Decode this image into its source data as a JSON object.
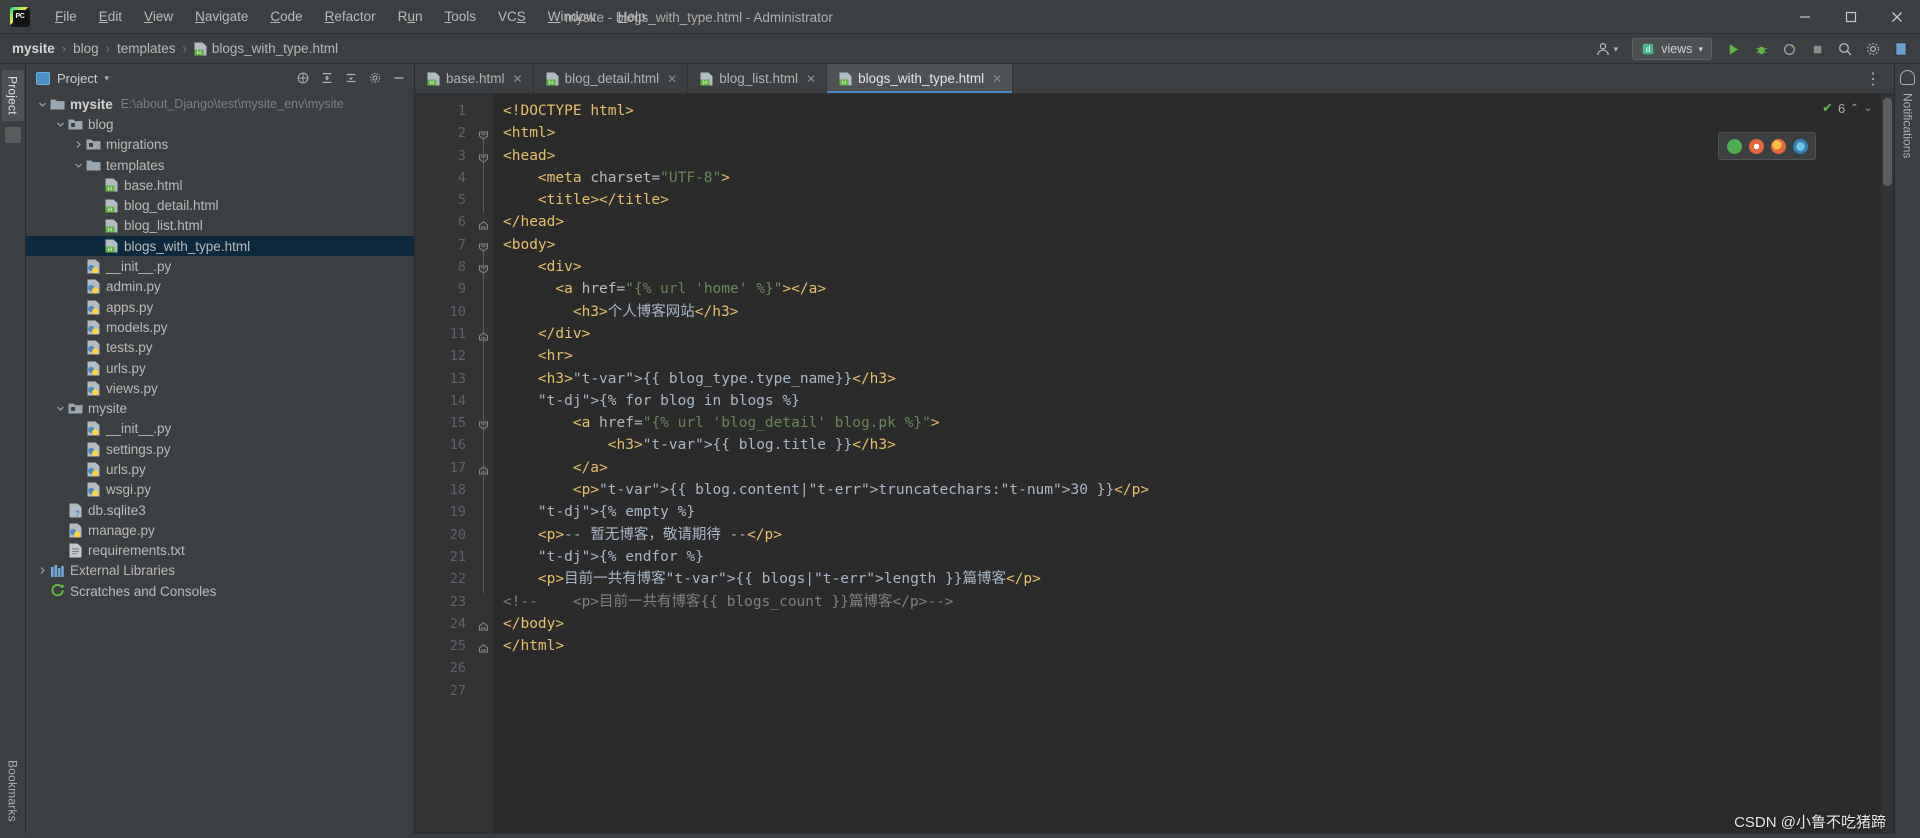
{
  "window": {
    "title": "mysite - blogs_with_type.html - Administrator",
    "logo_text": "PC",
    "minimize": "minimize-icon",
    "maximize": "maximize-icon",
    "close": "close-icon"
  },
  "menu": {
    "items": [
      {
        "label": "File",
        "mnemonic": "F"
      },
      {
        "label": "Edit",
        "mnemonic": "E"
      },
      {
        "label": "View",
        "mnemonic": "V"
      },
      {
        "label": "Navigate",
        "mnemonic": "N"
      },
      {
        "label": "Code",
        "mnemonic": "C"
      },
      {
        "label": "Refactor",
        "mnemonic": "R"
      },
      {
        "label": "Run",
        "mnemonic": "u"
      },
      {
        "label": "Tools",
        "mnemonic": "T"
      },
      {
        "label": "VCS",
        "mnemonic": "S"
      },
      {
        "label": "Window",
        "mnemonic": "W"
      },
      {
        "label": "Help",
        "mnemonic": "H"
      }
    ]
  },
  "breadcrumb": {
    "items": [
      "mysite",
      "blog",
      "templates",
      "blogs_with_type.html"
    ],
    "separator": "›"
  },
  "navbar_right": {
    "views_label": "views",
    "user_icon": "user-account-icon",
    "run_icon": "run-icon",
    "debug_icon": "debug-icon",
    "coverage_icon": "run-with-coverage-icon",
    "stop_icon": "stop-icon",
    "search_icon": "search-everywhere-icon",
    "settings_icon": "settings-gear-icon",
    "plugin_icon": "plugin-icon"
  },
  "left_strip": {
    "top_tab": "Project",
    "bottom_tab": "Bookmarks"
  },
  "right_strip": {
    "tab": "Notifications"
  },
  "project_panel": {
    "title": "Project",
    "dropdown_icon": "chevron-down-icon",
    "actions": [
      {
        "name": "expand-collapse-icon",
        "label": "⊕"
      },
      {
        "name": "collapse-all-icon",
        "label": "⤓"
      },
      {
        "name": "scroll-from-source-icon",
        "label": "↥"
      },
      {
        "name": "settings-gear-icon",
        "label": "⚙"
      },
      {
        "name": "hide-icon",
        "label": "—"
      }
    ],
    "tree": [
      {
        "label": "mysite",
        "path": "E:\\about_Django\\test\\mysite_env\\mysite",
        "icon": "folder-icon",
        "indent": 0,
        "arrow": "down",
        "bold": true,
        "selected": false
      },
      {
        "label": "blog",
        "path": "",
        "icon": "module-folder-icon",
        "indent": 1,
        "arrow": "down",
        "bold": false,
        "selected": false
      },
      {
        "label": "migrations",
        "path": "",
        "icon": "module-folder-icon",
        "indent": 2,
        "arrow": "right",
        "bold": false,
        "selected": false
      },
      {
        "label": "templates",
        "path": "",
        "icon": "folder-icon",
        "indent": 2,
        "arrow": "down",
        "bold": false,
        "selected": false
      },
      {
        "label": "base.html",
        "path": "",
        "icon": "html-file-icon",
        "indent": 3,
        "arrow": "none",
        "bold": false,
        "selected": false
      },
      {
        "label": "blog_detail.html",
        "path": "",
        "icon": "html-file-icon",
        "indent": 3,
        "arrow": "none",
        "bold": false,
        "selected": false
      },
      {
        "label": "blog_list.html",
        "path": "",
        "icon": "html-file-icon",
        "indent": 3,
        "arrow": "none",
        "bold": false,
        "selected": false
      },
      {
        "label": "blogs_with_type.html",
        "path": "",
        "icon": "html-file-icon",
        "indent": 3,
        "arrow": "none",
        "bold": false,
        "selected": true
      },
      {
        "label": "__init__.py",
        "path": "",
        "icon": "python-file-icon",
        "indent": 2,
        "arrow": "none",
        "bold": false,
        "selected": false
      },
      {
        "label": "admin.py",
        "path": "",
        "icon": "python-file-icon",
        "indent": 2,
        "arrow": "none",
        "bold": false,
        "selected": false
      },
      {
        "label": "apps.py",
        "path": "",
        "icon": "python-file-icon",
        "indent": 2,
        "arrow": "none",
        "bold": false,
        "selected": false
      },
      {
        "label": "models.py",
        "path": "",
        "icon": "python-file-icon",
        "indent": 2,
        "arrow": "none",
        "bold": false,
        "selected": false
      },
      {
        "label": "tests.py",
        "path": "",
        "icon": "python-file-icon",
        "indent": 2,
        "arrow": "none",
        "bold": false,
        "selected": false
      },
      {
        "label": "urls.py",
        "path": "",
        "icon": "python-file-icon",
        "indent": 2,
        "arrow": "none",
        "bold": false,
        "selected": false
      },
      {
        "label": "views.py",
        "path": "",
        "icon": "python-file-icon",
        "indent": 2,
        "arrow": "none",
        "bold": false,
        "selected": false
      },
      {
        "label": "mysite",
        "path": "",
        "icon": "module-folder-icon",
        "indent": 1,
        "arrow": "down",
        "bold": false,
        "selected": false
      },
      {
        "label": "__init__.py",
        "path": "",
        "icon": "python-file-icon",
        "indent": 2,
        "arrow": "none",
        "bold": false,
        "selected": false
      },
      {
        "label": "settings.py",
        "path": "",
        "icon": "python-file-icon",
        "indent": 2,
        "arrow": "none",
        "bold": false,
        "selected": false
      },
      {
        "label": "urls.py",
        "path": "",
        "icon": "python-file-icon",
        "indent": 2,
        "arrow": "none",
        "bold": false,
        "selected": false
      },
      {
        "label": "wsgi.py",
        "path": "",
        "icon": "python-file-icon",
        "indent": 2,
        "arrow": "none",
        "bold": false,
        "selected": false
      },
      {
        "label": "db.sqlite3",
        "path": "",
        "icon": "database-file-icon",
        "indent": 1,
        "arrow": "none",
        "bold": false,
        "selected": false
      },
      {
        "label": "manage.py",
        "path": "",
        "icon": "python-file-icon",
        "indent": 1,
        "arrow": "none",
        "bold": false,
        "selected": false
      },
      {
        "label": "requirements.txt",
        "path": "",
        "icon": "text-file-icon",
        "indent": 1,
        "arrow": "none",
        "bold": false,
        "selected": false
      },
      {
        "label": "External Libraries",
        "path": "",
        "icon": "libraries-icon",
        "indent": 0,
        "arrow": "right",
        "bold": false,
        "selected": false
      },
      {
        "label": "Scratches and Consoles",
        "path": "",
        "icon": "scratches-icon",
        "indent": 0,
        "arrow": "none",
        "bold": false,
        "selected": false
      }
    ]
  },
  "editor": {
    "tabs": [
      {
        "label": "base.html",
        "icon": "html-file-icon",
        "active": false
      },
      {
        "label": "blog_detail.html",
        "icon": "html-file-icon",
        "active": false
      },
      {
        "label": "blog_list.html",
        "icon": "html-file-icon",
        "active": false
      },
      {
        "label": "blogs_with_type.html",
        "icon": "html-file-icon",
        "active": true
      }
    ],
    "close_icon": "close-tab-icon",
    "kebab_icon": "more-options-icon",
    "inspection_count": "6",
    "inspection_icon": "inspections-ok-icon",
    "floating_toolbar": [
      {
        "name": "wechat-browser-icon",
        "color": "#4caf50"
      },
      {
        "name": "chrome-browser-icon",
        "color": "#e8683e"
      },
      {
        "name": "firefox-browser-icon",
        "color": "#f08a3c"
      },
      {
        "name": "edge-browser-icon",
        "color": "#3b9fd4"
      }
    ],
    "total_lines": 27,
    "lines": [
      {
        "n": 1,
        "fold": "none",
        "indent": 0
      },
      {
        "n": 2,
        "fold": "open",
        "indent": 0
      },
      {
        "n": 3,
        "fold": "open",
        "indent": 0
      },
      {
        "n": 4,
        "fold": "none",
        "indent": 1
      },
      {
        "n": 5,
        "fold": "none",
        "indent": 1
      },
      {
        "n": 6,
        "fold": "close",
        "indent": 0
      },
      {
        "n": 7,
        "fold": "open",
        "indent": 0
      },
      {
        "n": 8,
        "fold": "open",
        "indent": 1
      },
      {
        "n": 9,
        "fold": "none",
        "indent": 2
      },
      {
        "n": 10,
        "fold": "none",
        "indent": 3
      },
      {
        "n": 11,
        "fold": "close",
        "indent": 1
      },
      {
        "n": 12,
        "fold": "none",
        "indent": 1
      },
      {
        "n": 13,
        "fold": "none",
        "indent": 1
      },
      {
        "n": 14,
        "fold": "none",
        "indent": 1
      },
      {
        "n": 15,
        "fold": "open",
        "indent": 2
      },
      {
        "n": 16,
        "fold": "none",
        "indent": 3
      },
      {
        "n": 17,
        "fold": "close",
        "indent": 2
      },
      {
        "n": 18,
        "fold": "none",
        "indent": 2
      },
      {
        "n": 19,
        "fold": "none",
        "indent": 1
      },
      {
        "n": 20,
        "fold": "none",
        "indent": 1
      },
      {
        "n": 21,
        "fold": "none",
        "indent": 1
      },
      {
        "n": 22,
        "fold": "none",
        "indent": 1
      },
      {
        "n": 23,
        "fold": "none",
        "indent": 0
      },
      {
        "n": 24,
        "fold": "close",
        "indent": 0
      },
      {
        "n": 25,
        "fold": "close",
        "indent": 0
      },
      {
        "n": 26,
        "fold": "none",
        "indent": 0
      },
      {
        "n": 27,
        "fold": "none",
        "indent": 0
      }
    ],
    "code_text": [
      "<!DOCTYPE html>",
      "<html>",
      "<head>",
      "    <meta charset=\"UTF-8\">",
      "    <title></title>",
      "</head>",
      "<body>",
      "    <div>",
      "      <a href=\"{% url 'home' %}\"></a>",
      "        <h3>个人博客网站</h3>",
      "    </div>",
      "    <hr>",
      "    <h3>{{ blog_type.type_name}}</h3>",
      "    {% for blog in blogs %}",
      "        <a href=\"{% url 'blog_detail' blog.pk %}\">",
      "            <h3>{{ blog.title }}</h3>",
      "        </a>",
      "        <p>{{ blog.content|truncatechars:30 }}</p>",
      "    {% empty %}",
      "    <p>-- 暂无博客，敬请期待 --</p>",
      "    {% endfor %}",
      "    <p>目前一共有博客{{ blogs|length }}篇博客</p>",
      "<!--    <p>目前一共有博客{{ blogs_count }}篇博客</p>-->",
      "</body>",
      "</html>",
      "",
      ""
    ]
  },
  "watermark": "CSDN @小鲁不吃猪蹄",
  "colors": {
    "background": "#3c3f41",
    "editor_background": "#2b2b2b",
    "gutter": "#313335",
    "selection": "#0d293e",
    "tag": "#e8bf6a",
    "string": "#6a8759",
    "django": "#9ec07c",
    "comment": "#808080",
    "accent": "#4a88c7",
    "green": "#62b543"
  }
}
